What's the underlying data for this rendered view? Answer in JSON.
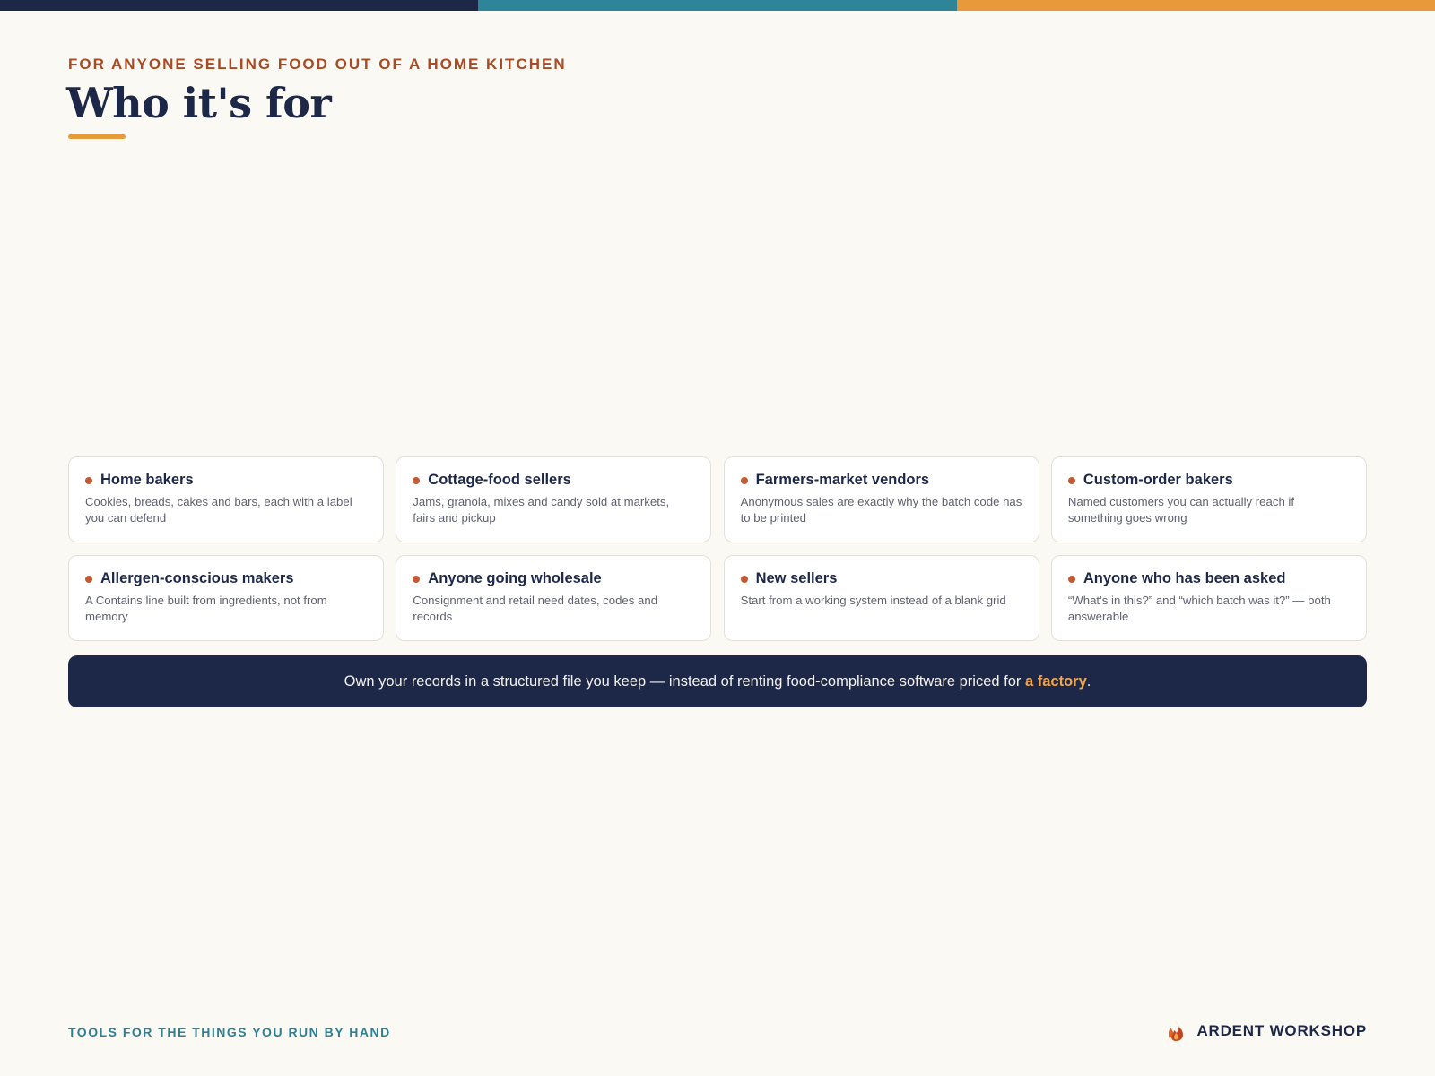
{
  "colors": {
    "navy": "#1D2747",
    "teal": "#2E8598",
    "orange": "#E89A3A",
    "rust": "#A84A24",
    "dot": "#C25A33",
    "highlight": "#F2A64A"
  },
  "header": {
    "eyebrow": "FOR ANYONE SELLING FOOD OUT OF A HOME KITCHEN",
    "title": "Who it's for"
  },
  "cards": [
    {
      "title": "Home bakers",
      "desc": "Cookies, breads, cakes and bars, each with a label you can defend"
    },
    {
      "title": "Cottage-food sellers",
      "desc": "Jams, granola, mixes and candy sold at markets, fairs and pickup"
    },
    {
      "title": "Farmers-market vendors",
      "desc": "Anonymous sales are exactly why the batch code has to be printed"
    },
    {
      "title": "Custom-order bakers",
      "desc": "Named customers you can actually reach if something goes wrong"
    },
    {
      "title": "Allergen-conscious makers",
      "desc": "A Contains line built from ingredients, not from memory"
    },
    {
      "title": "Anyone going wholesale",
      "desc": "Consignment and retail need dates, codes and records"
    },
    {
      "title": "New sellers",
      "desc": "Start from a working system instead of a blank grid"
    },
    {
      "title": "Anyone who has been asked",
      "desc": "“What’s in this?” and “which batch was it?” — both answerable"
    }
  ],
  "banner": {
    "text": "Own your records in a structured file you keep — instead of renting food-compliance software priced for ",
    "highlight": "a factory",
    "end": "."
  },
  "footer": {
    "tagline": "TOOLS FOR THE THINGS YOU RUN BY HAND",
    "brand": "ARDENT WORKSHOP",
    "brand_icon": "flame-icon"
  }
}
